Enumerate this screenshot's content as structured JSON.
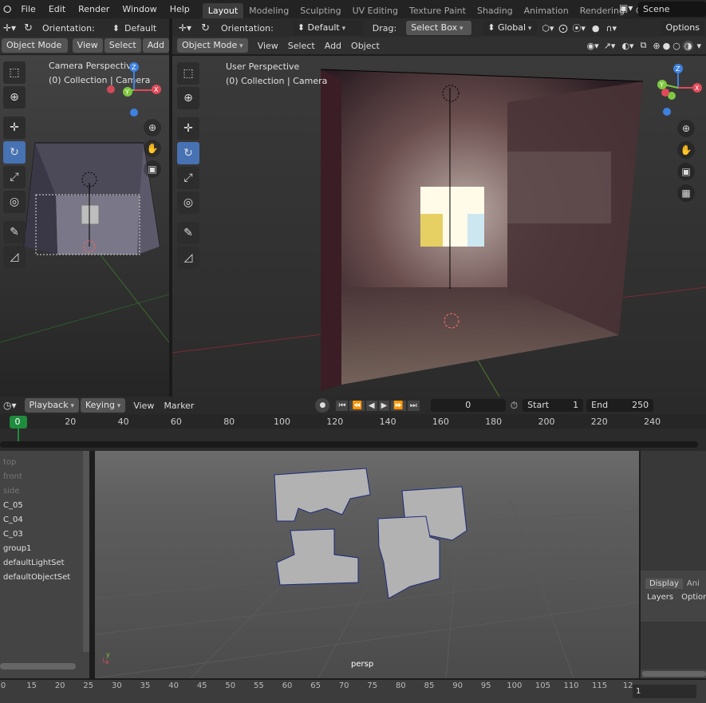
{
  "topbar": {
    "menus": [
      "File",
      "Edit",
      "Render",
      "Window",
      "Help"
    ],
    "tabs": [
      "Layout",
      "Modeling",
      "Sculpting",
      "UV Editing",
      "Texture Paint",
      "Shading",
      "Animation",
      "Rendering",
      "Compo"
    ],
    "active_tab": "Layout",
    "scene": "Scene"
  },
  "left_header": {
    "orientation_label": "Orientation:",
    "orientation_value": "Default",
    "mode": "Object Mode",
    "view": "View",
    "select": "Select",
    "add": "Add"
  },
  "main_header": {
    "orientation_label": "Orientation:",
    "orientation_value": "Default",
    "drag_label": "Drag:",
    "drag_value": "Select Box",
    "transform": "Global",
    "options": "Options",
    "mode": "Object Mode",
    "view": "View",
    "select": "Select",
    "add": "Add",
    "object": "Object"
  },
  "left_viewport": {
    "title": "Camera Perspective",
    "subtitle": "(0) Collection | Camera"
  },
  "main_viewport": {
    "title": "User Perspective",
    "subtitle": "(0) Collection | Camera"
  },
  "timeline": {
    "playback": "Playback",
    "keying": "Keying",
    "view": "View",
    "marker": "Marker",
    "current_frame": "0",
    "start_label": "Start",
    "start": "1",
    "end_label": "End",
    "end": "250",
    "ticks": [
      "0",
      "20",
      "40",
      "60",
      "80",
      "100",
      "120",
      "140",
      "160",
      "180",
      "200",
      "220",
      "240"
    ]
  },
  "maya": {
    "outliner": [
      {
        "label": "top",
        "dim": true
      },
      {
        "label": "front",
        "dim": true
      },
      {
        "label": "side",
        "dim": true
      },
      {
        "label": "C_05",
        "dim": false
      },
      {
        "label": "C_04",
        "dim": false
      },
      {
        "label": "C_03",
        "dim": false
      },
      {
        "label": "group1",
        "dim": false
      },
      {
        "label": "defaultLightSet",
        "dim": false
      },
      {
        "label": "defaultObjectSet",
        "dim": false
      }
    ],
    "viewport_label": "persp",
    "display_tab": "Display",
    "anim_tab": "Ani",
    "layers": "Layers",
    "options": "Option",
    "ruler_ticks": [
      "0",
      "15",
      "20",
      "25",
      "30",
      "35",
      "40",
      "45",
      "50",
      "55",
      "60",
      "65",
      "70",
      "75",
      "80",
      "85",
      "90",
      "95",
      "100",
      "105",
      "110",
      "115",
      "12"
    ],
    "frame_field": "1"
  },
  "colors": {
    "accent": "#4772b3",
    "axis_x": "#e04a5a",
    "axis_y": "#7fc740",
    "axis_z": "#3e82e0",
    "frame_green": "#1f8b3c"
  }
}
